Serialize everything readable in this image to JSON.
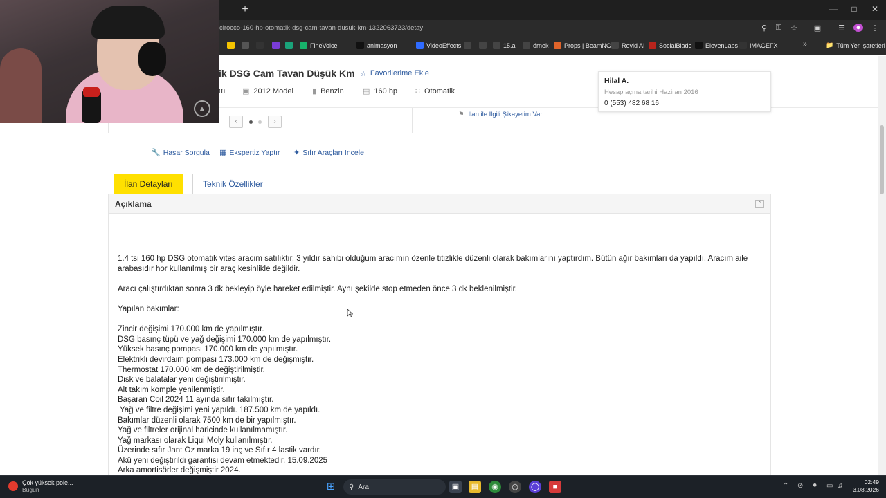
{
  "browser": {
    "url": "cirocco-160-hp-otomatik-dsg-cam-tavan-dusuk-km-1322063723/detay",
    "new_tab": "+",
    "bookmarks": [
      {
        "label": "",
        "icon": "arrow-icon",
        "color": "#f5c400"
      },
      {
        "label": "",
        "icon": "alien-icon",
        "color": "#555"
      },
      {
        "label": "",
        "icon": "circle-icon",
        "color": "#333"
      },
      {
        "label": "",
        "icon": "play-icon",
        "color": "#7a3cd6"
      },
      {
        "label": "",
        "icon": "grid-icon",
        "color": "#1aa37a"
      },
      {
        "label": "FineVoice",
        "icon": "f-icon",
        "color": "#18b26b"
      },
      {
        "label": "animasyon",
        "icon": "p-icon",
        "color": "#111"
      },
      {
        "label": "VideoEffects",
        "icon": "v-icon",
        "color": "#2f6bff"
      },
      {
        "label": "",
        "icon": "bb-icon",
        "color": "#444"
      },
      {
        "label": "",
        "icon": "x-icon",
        "color": "#444"
      },
      {
        "label": "15.ai",
        "icon": "tool-icon",
        "color": "#444"
      },
      {
        "label": "örnek",
        "icon": "o-icon",
        "color": "#444"
      },
      {
        "label": "Props | BeamNG",
        "icon": "beamng-icon",
        "color": "#e0642a"
      },
      {
        "label": "Revid AI",
        "icon": "revid-icon",
        "color": "#444"
      },
      {
        "label": "SocialBlade",
        "icon": "socialblade-icon",
        "color": "#b8241c"
      },
      {
        "label": "ElevenLabs",
        "icon": "elevenlabs-icon",
        "color": "#111"
      },
      {
        "label": "IMAGEFX",
        "icon": "imagefx-icon",
        "color": "#333"
      }
    ],
    "more_bookmarks": "»",
    "all_bookmarks": "Tüm Yer İşaretleri"
  },
  "listing": {
    "title_partial": "ik DSG Cam Tavan Düşük Km",
    "favorite_label": "Favorilerime Ekle",
    "info": {
      "km_partial": "m",
      "model": "2012 Model",
      "fuel": "Benzin",
      "power": "160 hp",
      "gear": "Otomatik"
    },
    "complaint_label": "İlan ile İlgili Şikayetim Var"
  },
  "seller": {
    "name": "Hilal A.",
    "since": "Hesap açma tarihi  Haziran 2016",
    "phone": "0 (553) 482 68 16"
  },
  "tools": {
    "hasar": "Hasar Sorgula",
    "ekspertiz": "Ekspertiz Yaptır",
    "sifir": "Sıfır Araçları İncele"
  },
  "tabs": {
    "detay": "İlan Detayları",
    "teknik": "Teknik Özellikler"
  },
  "description": {
    "heading": "Açıklama",
    "para1": "1.4 tsi 160 hp DSG otomatik vites aracım satılıktır. 3 yıldır sahibi olduğum aracımın özenle titizlikle düzenli olarak bakımlarını yaptırdım. Bütün ağır bakımları da yapıldı. Aracım aile arabasıdır hor kullanılmış bir araç kesinlikle değildir.",
    "para2": "Aracı çalıştırdıktan sonra 3 dk bekleyip öyle hareket edilmiştir. Aynı şekilde stop etmeden önce 3 dk beklenilmiştir.",
    "para3": "Yapılan bakımlar:",
    "lines": [
      "Zincir değişimi 170.000 km de yapılmıştır.",
      "DSG basınç tüpü ve yağ değişimi 170.000 km de yapılmıştır.",
      "Yüksek basınç pompası 170.000 km de yapılmıştır.",
      "Elektrikli devirdaim pompası 173.000 km de değişmiştir.",
      "Thermostat 170.000 km de değiştirilmiştir.",
      "Disk ve balatalar yeni değiştirilmiştir.",
      "Alt takım komple yenilenmiştir.",
      "Başaran Coil 2024 11 ayında sıfır takılmıştır.",
      " Yağ ve filtre değişimi yeni yapıldı. 187.500 km de yapıldı.",
      "Bakımlar düzenli olarak 7500 km de bir yapılmıştır.",
      "Yağ ve filtreler orijinal haricinde kullanılmamıştır.",
      "Yağ markası olarak Liqui Moly kullanılmıştır.",
      "Üzerinde sıfır Jant Oz marka 19 inç ve Sıfır 4 lastik vardır.",
      "Akü yeni değiştirildi garantisi devam etmektedir. 15.09.2025",
      "Arka amortisörler değişmiştir 2024."
    ]
  },
  "taskbar": {
    "weather_title": "Çok yüksek pole...",
    "weather_sub": "Bugün",
    "search_label": "Ara",
    "time": "02:49",
    "date": "3.08.2026"
  },
  "colors": {
    "accent_yellow": "#ffe000",
    "link_blue": "#2d5a9e",
    "chrome_dark": "#2b2b2b",
    "taskbar": "#1c2127"
  }
}
